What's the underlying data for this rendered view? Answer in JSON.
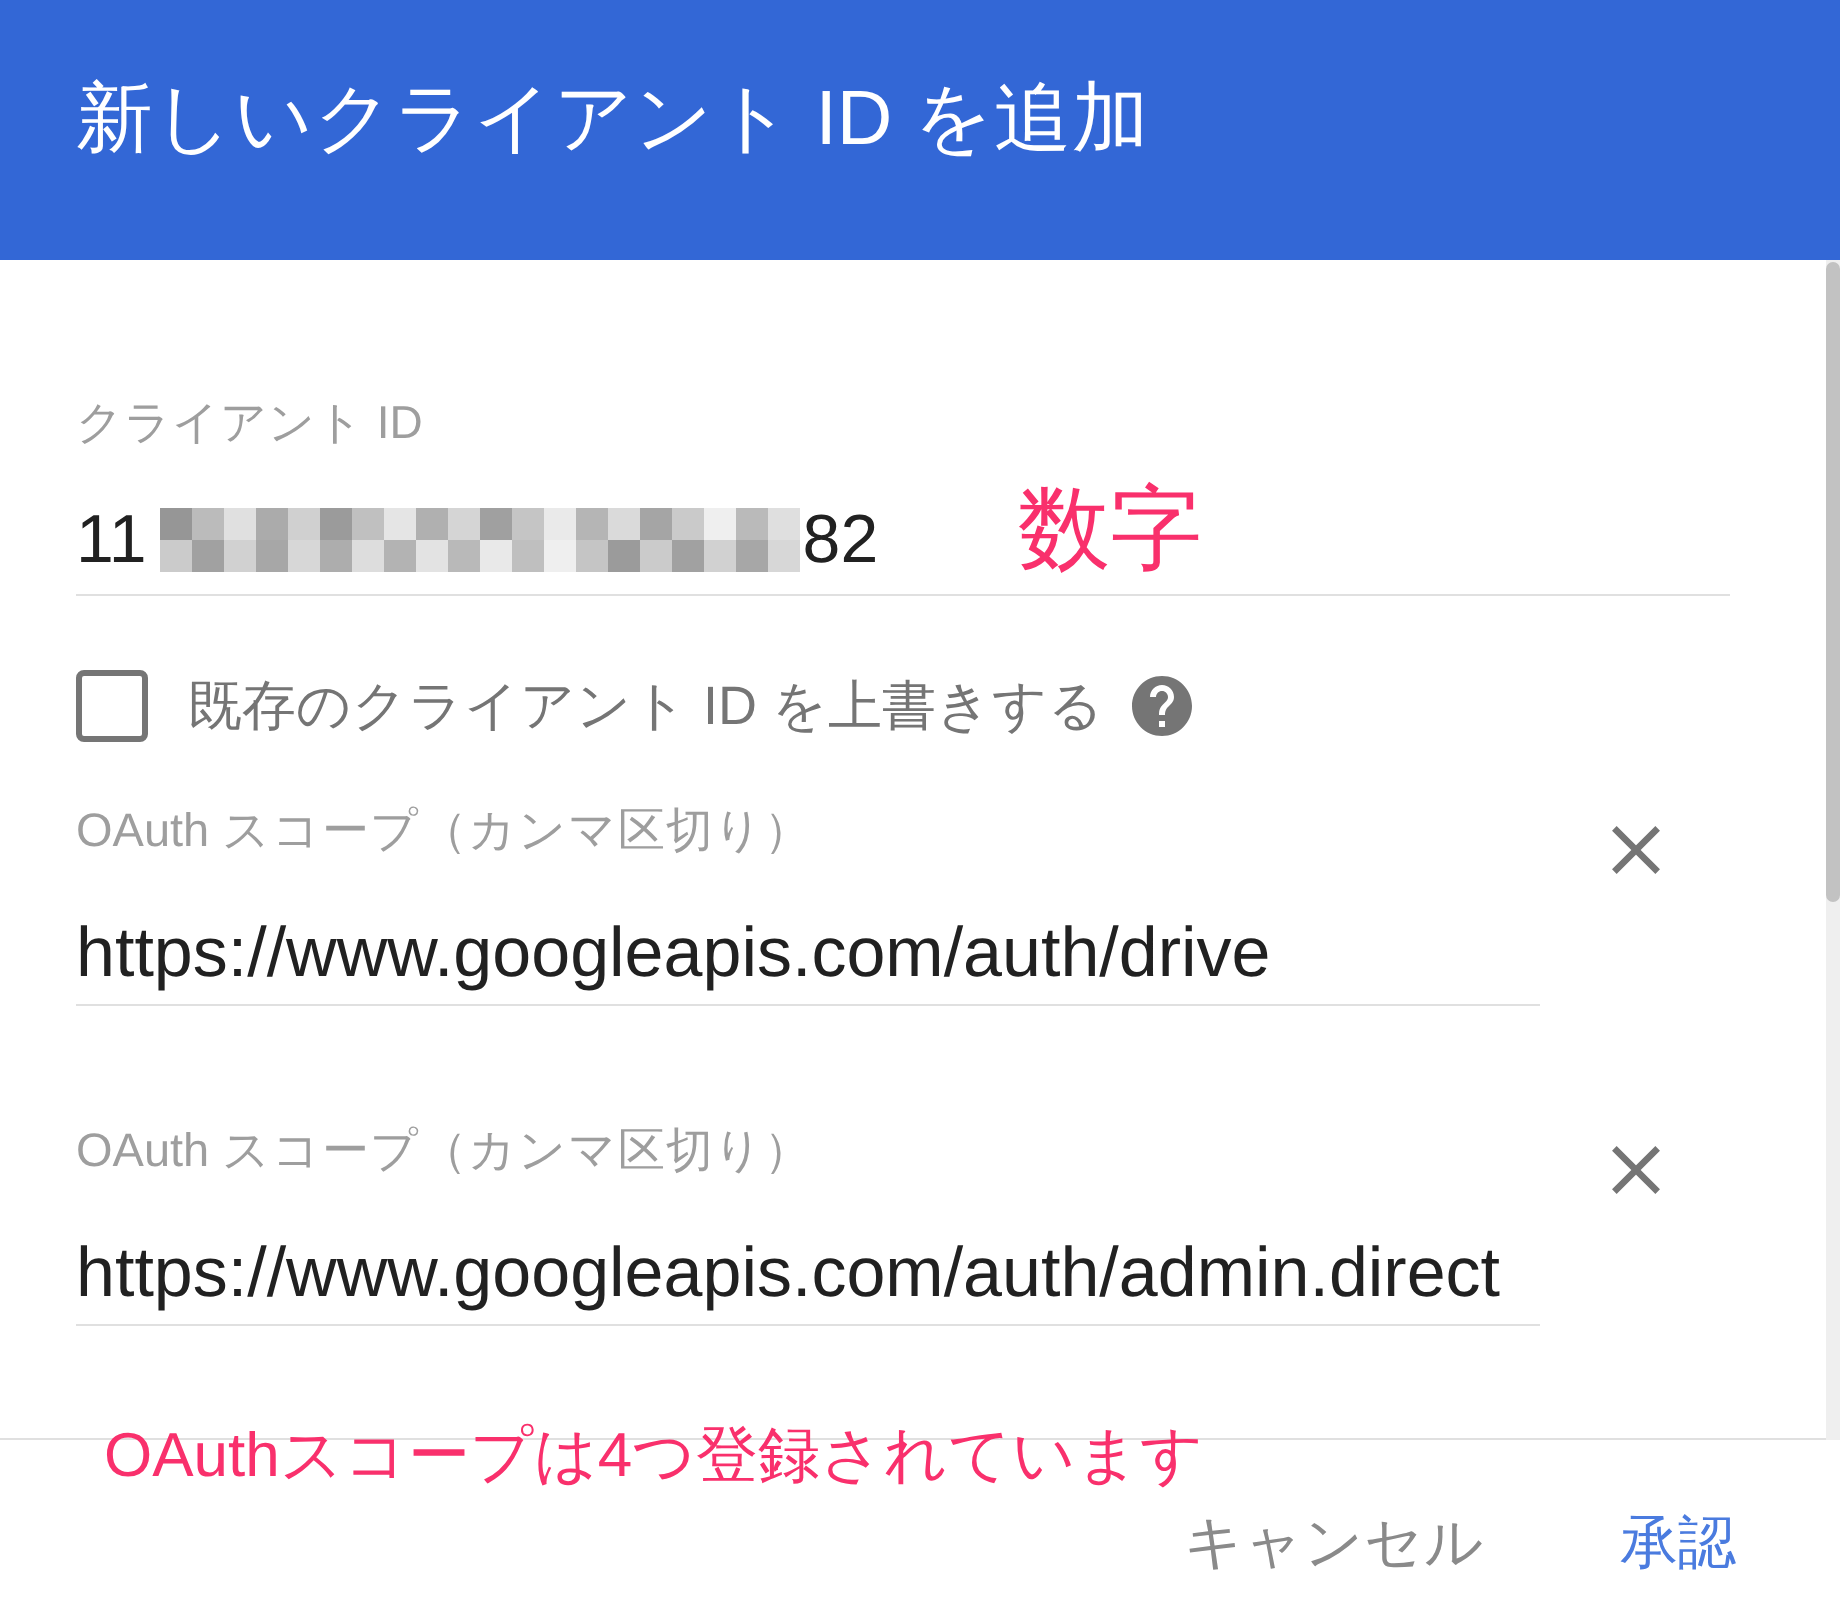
{
  "dialog": {
    "title": "新しいクライアント ID を追加"
  },
  "client_id": {
    "label": "クライアント ID",
    "value_start": "11",
    "value_end": "82",
    "redacted": true,
    "annotation": "数字"
  },
  "overwrite": {
    "label": "既存のクライアント ID を上書きする",
    "checked": false
  },
  "scopes": [
    {
      "label": "OAuth スコープ（カンマ区切り）",
      "value": "https://www.googleapis.com/auth/drive"
    },
    {
      "label": "OAuth スコープ（カンマ区切り）",
      "value": "https://www.googleapis.com/auth/admin.direct"
    }
  ],
  "footer": {
    "annotation": "OAuthスコープは4つ登録されています",
    "buttons": [
      {
        "label": "キャンセル",
        "kind": "secondary"
      },
      {
        "label": "承認",
        "kind": "primary"
      }
    ]
  }
}
